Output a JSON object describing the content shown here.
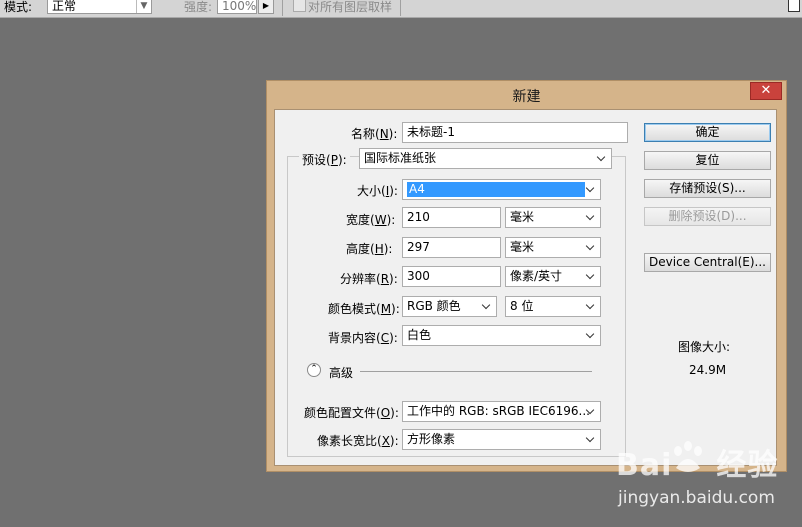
{
  "options_bar": {
    "mode_label": "模式:",
    "mode_value": "正常",
    "strength_label": "强度:",
    "strength_value": "100%",
    "sample_all_layers_label": "对所有图层取样"
  },
  "dialog": {
    "title": "新建",
    "close_glyph": "✕",
    "name": {
      "label_prefix": "名称(",
      "key": "N",
      "label_suffix": "):",
      "value": "未标题-1"
    },
    "preset": {
      "label_prefix": "预设(",
      "key": "P",
      "label_suffix": "):",
      "value": "国际标准纸张"
    },
    "size": {
      "label_prefix": "大小(",
      "key": "I",
      "label_suffix": "):",
      "value": "A4"
    },
    "width": {
      "label_prefix": "宽度(",
      "key": "W",
      "label_suffix": "):",
      "value": "210",
      "unit": "毫米"
    },
    "height": {
      "label_prefix": "高度(",
      "key": "H",
      "label_suffix": "):",
      "value": "297",
      "unit": "毫米"
    },
    "resolution": {
      "label_prefix": "分辨率(",
      "key": "R",
      "label_suffix": "):",
      "value": "300",
      "unit": "像素/英寸"
    },
    "color_mode": {
      "label_prefix": "颜色模式(",
      "key": "M",
      "label_suffix": "):",
      "value": "RGB 颜色",
      "depth": "8 位"
    },
    "background": {
      "label_prefix": "背景内容(",
      "key": "C",
      "label_suffix": "):",
      "value": "白色"
    },
    "advanced_label": "高级",
    "color_profile": {
      "label_prefix": "颜色配置文件(",
      "key": "O",
      "label_suffix": "):",
      "value": "工作中的 RGB: sRGB IEC6196..."
    },
    "pixel_aspect": {
      "label_prefix": "像素长宽比(",
      "key": "X",
      "label_suffix": "):",
      "value": "方形像素"
    },
    "buttons": {
      "ok": "确定",
      "reset": "复位",
      "save_preset": "存储预设(S)...",
      "delete_preset": "删除预设(D)...",
      "device_central": "Device Central(E)..."
    },
    "image_size_label": "图像大小:",
    "image_size_value": "24.9M"
  },
  "watermark": {
    "logo_text": "Bai",
    "logo_suffix": "经验",
    "url": "jingyan.baidu.com"
  },
  "colors": {
    "workspace": "#707070",
    "dialog_frame": "#d5b48a",
    "close_button": "#c9423c",
    "selection": "#3399ff"
  }
}
